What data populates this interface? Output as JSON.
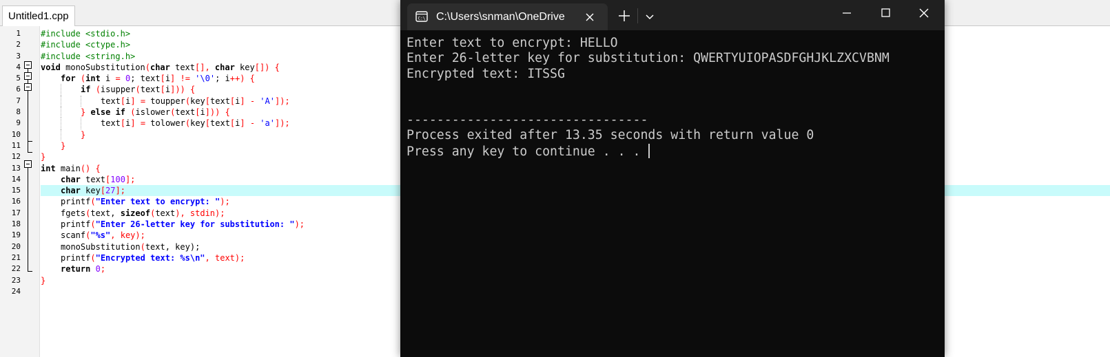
{
  "editor": {
    "tab_label": "Untitled1.cpp",
    "line_numbers": [
      "1",
      "2",
      "3",
      "4",
      "5",
      "6",
      "7",
      "8",
      "9",
      "10",
      "11",
      "12",
      "13",
      "14",
      "15",
      "16",
      "17",
      "18",
      "19",
      "20",
      "21",
      "22",
      "23",
      "24"
    ],
    "highlighted_line": 15
  },
  "code": {
    "l1": "#include <stdio.h>",
    "l2": "#include <ctype.h>",
    "l3": "#include <string.h>",
    "l4a": "void",
    "l4b": " monoSubstitution",
    "l4c": "(",
    "l4d": "char",
    "l4e": " text",
    "l4f": "[], ",
    "l4g": "char",
    "l4h": " key",
    "l4i": "[]) {",
    "l5a": "for",
    "l5b": " (",
    "l5c": "int",
    "l5d": " i ",
    "l5e": "=",
    "l5f": " ",
    "l5g": "0",
    "l5h": "; text",
    "l5i": "[",
    "l5j": "i",
    "l5k": "] != ",
    "l5l": "'\\0'",
    "l5m": "; i",
    "l5n": "++",
    "l5o": ") {",
    "l6a": "if",
    "l6b": " ",
    "l6c": "(",
    "l6d": "isupper",
    "l6e": "(",
    "l6f": "text",
    "l6g": "[",
    "l6h": "i",
    "l6i": "])) {",
    "l7a": "text",
    "l7b": "[",
    "l7c": "i",
    "l7d": "] = ",
    "l7e": "toupper",
    "l7f": "(",
    "l7g": "key",
    "l7h": "[",
    "l7i": "text",
    "l7j": "[",
    "l7k": "i",
    "l7l": "] - ",
    "l7m": "'A'",
    "l7n": "]);",
    "l8a": "} ",
    "l8b": "else if",
    "l8c": " (",
    "l8d": "islower",
    "l8e": "(",
    "l8f": "text",
    "l8g": "[",
    "l8h": "i",
    "l8i": "])) {",
    "l9a": "text",
    "l9b": "[",
    "l9c": "i",
    "l9d": "] = ",
    "l9e": "tolower",
    "l9f": "(",
    "l9g": "key",
    "l9h": "[",
    "l9i": "text",
    "l9j": "[",
    "l9k": "i",
    "l9l": "] - ",
    "l9m": "'a'",
    "l9n": "]);",
    "l10": "}",
    "l11": "}",
    "l12": "}",
    "l13a": "int",
    "l13b": " main",
    "l13c": "() {",
    "l14a": "char",
    "l14b": " text",
    "l14c": "[",
    "l14d": "100",
    "l14e": "];",
    "l15a": "char",
    "l15b": " key",
    "l15c": "[",
    "l15d": "27",
    "l15e": "];",
    "l16a": "printf",
    "l16b": "(",
    "l16c": "\"Enter text to encrypt: \"",
    "l16d": ");",
    "l17a": "fgets",
    "l17b": "(",
    "l17c": "text, ",
    "l17d": "sizeof",
    "l17e": "(",
    "l17f": "text",
    "l17g": "), stdin);",
    "l18a": "printf",
    "l18b": "(",
    "l18c": "\"Enter 26-letter key for substitution: \"",
    "l18d": ");",
    "l19a": "scanf",
    "l19b": "(",
    "l19c": "\"%s\"",
    "l19d": ", key);",
    "l20a": "monoSubstitution",
    "l20b": "(",
    "l20c": "text, key);",
    "l21a": "printf",
    "l21b": "(",
    "l21c": "\"Encrypted text: %s\\n\"",
    "l21d": ", text);",
    "l22a": "return",
    "l22b": " ",
    "l22c": "0",
    "l22d": ";",
    "l23": "}"
  },
  "terminal": {
    "tab_title": "C:\\Users\\snman\\OneDrive",
    "lines": [
      "Enter text to encrypt: HELLO",
      "Enter 26-letter key for substitution: QWERTYUIOPASDFGHJKLZXCVBNM",
      "Encrypted text: ITSSG",
      "",
      "",
      "--------------------------------",
      "Process exited after 13.35 seconds with return value 0",
      "Press any key to continue . . . "
    ]
  }
}
